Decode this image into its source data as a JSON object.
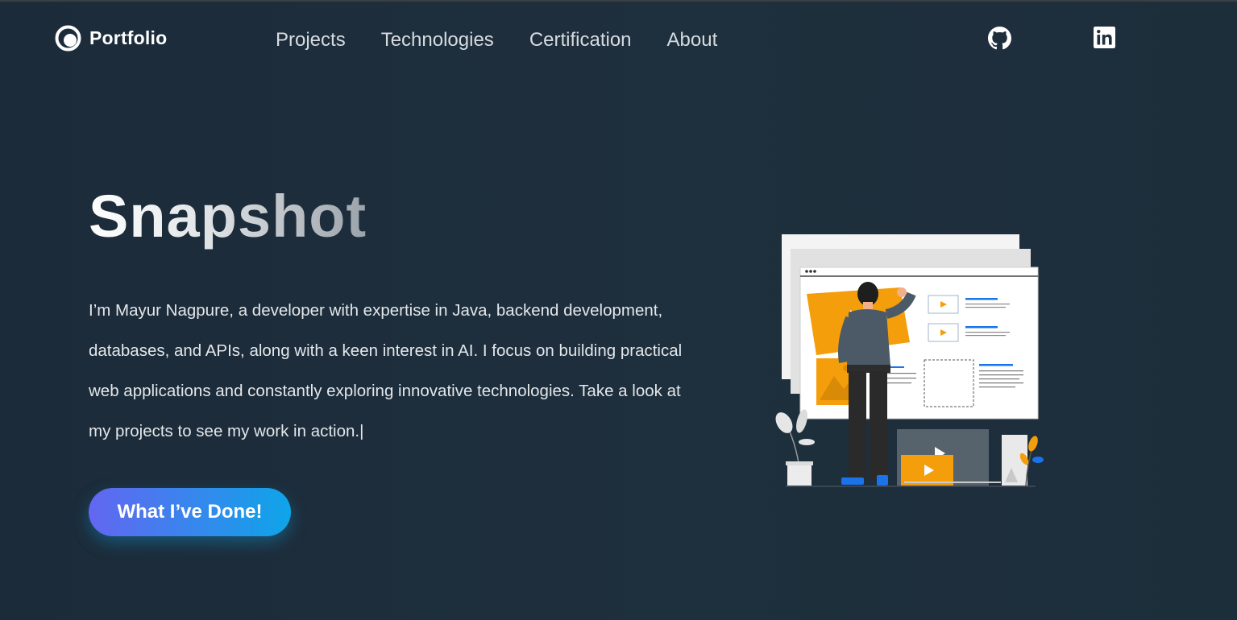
{
  "brand": {
    "name": "Portfolio",
    "logo_icon": "circle-logo-icon"
  },
  "nav": {
    "items": [
      {
        "label": "Projects"
      },
      {
        "label": "Technologies"
      },
      {
        "label": "Certification"
      },
      {
        "label": "About"
      }
    ]
  },
  "social": {
    "github_icon": "github-icon",
    "linkedin_icon": "linkedin-icon"
  },
  "hero": {
    "title": "Snapshot",
    "description": "I’m Mayur Nagpure, a developer with expertise in Java, backend development, databases, and APIs, along with a keen interest in AI. I focus on building practical web applications and constantly exploring innovative technologies. Take a look at my projects to see my work in action.|",
    "cta_label": "What I’ve Done!"
  },
  "colors": {
    "background": "#1e2f3d",
    "accent_start": "#6366f1",
    "accent_end": "#0ea5e9",
    "illustration_orange": "#f59e0b",
    "illustration_blue": "#1a73e8"
  }
}
